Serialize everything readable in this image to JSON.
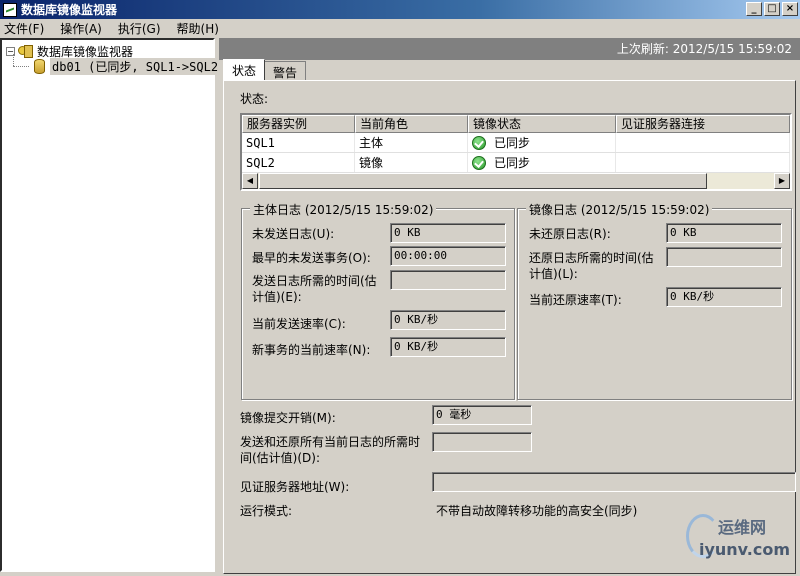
{
  "window": {
    "title": "数据库镜像监视器",
    "buttons": [
      "_",
      "□",
      "×"
    ]
  },
  "menu": [
    "文件(F)",
    "操作(A)",
    "执行(G)",
    "帮助(H)"
  ],
  "tree": {
    "root_label": "数据库镜像监视器",
    "child_label": "db01 (已同步, SQL1->SQL2)"
  },
  "header": {
    "last_refresh": "上次刷新: 2012/5/15 15:59:02"
  },
  "tabs": [
    {
      "label": "状态"
    },
    {
      "label": "警告"
    }
  ],
  "status": {
    "label": "状态:",
    "columns": [
      "服务器实例",
      "当前角色",
      "镜像状态",
      "见证服务器连接"
    ],
    "rows": [
      {
        "instance": "SQL1",
        "role": "主体",
        "state": "已同步",
        "witness": ""
      },
      {
        "instance": "SQL2",
        "role": "镜像",
        "state": "已同步",
        "witness": ""
      }
    ]
  },
  "principal_log": {
    "title": "主体日志 (2012/5/15 15:59:02)",
    "unsent_label": "未发送日志(U):",
    "unsent_value": "0 KB",
    "oldest_unsent_label": "最早的未发送事务(O):",
    "oldest_unsent_value": "00:00:00",
    "time_to_send_label": "发送日志所需的时间(估计值)(E):",
    "time_to_send_value": "",
    "send_rate_label": "当前发送速率(C):",
    "send_rate_value": "0 KB/秒",
    "new_tx_rate_label": "新事务的当前速率(N):",
    "new_tx_rate_value": "0 KB/秒"
  },
  "mirror_log": {
    "title": "镜像日志 (2012/5/15 15:59:02)",
    "unrestored_label": "未还原日志(R):",
    "unrestored_value": "0 KB",
    "time_to_restore_label": "还原日志所需的时间(估计值)(L):",
    "time_to_restore_value": "",
    "restore_rate_label": "当前还原速率(T):",
    "restore_rate_value": "0 KB/秒"
  },
  "summary": {
    "commit_overhead_label": "镜像提交开销(M):",
    "commit_overhead_value": "0 毫秒",
    "time_to_send_restore_label": "发送和还原所有当前日志的所需时间(估计值)(D):",
    "time_to_send_restore_value": "",
    "witness_address_label": "见证服务器地址(W):",
    "witness_address_value": "",
    "operating_mode_label": "运行模式:",
    "operating_mode_value": "不带自动故障转移功能的高安全(同步)"
  },
  "watermark": {
    "line1": "运维网",
    "line2": "iyunv.com"
  }
}
